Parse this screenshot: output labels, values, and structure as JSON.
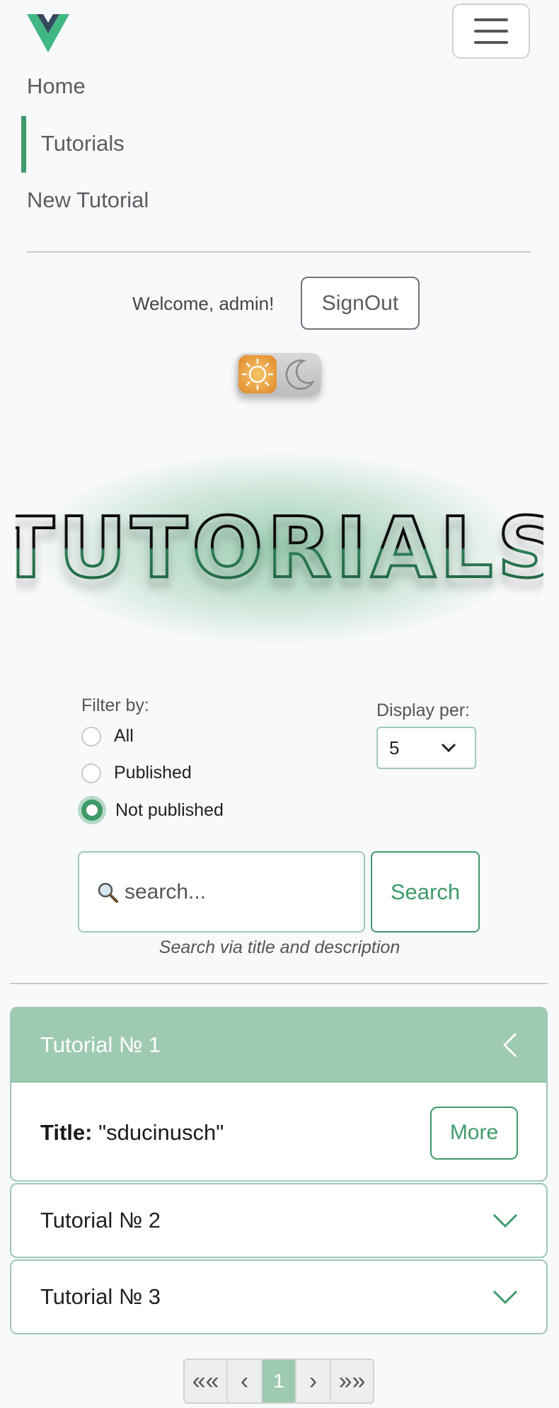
{
  "nav": {
    "items": [
      {
        "label": "Home",
        "active": false
      },
      {
        "label": "Tutorials",
        "active": true
      },
      {
        "label": "New Tutorial",
        "active": false
      }
    ],
    "menu_icon": "hamburger-icon"
  },
  "user": {
    "welcome": "Welcome, admin!",
    "signout_label": "SignOut"
  },
  "theme_toggle": {
    "light_icon": "sun-icon",
    "dark_icon": "moon-icon",
    "mode": "light"
  },
  "banner": {
    "title": "TUTORIALS"
  },
  "filter": {
    "label": "Filter by:",
    "options": [
      {
        "label": "All",
        "checked": false
      },
      {
        "label": "Published",
        "checked": false
      },
      {
        "label": "Not published",
        "checked": true
      }
    ]
  },
  "display": {
    "label": "Display per:",
    "value": "5"
  },
  "search": {
    "placeholder": "search...",
    "button_label": "Search",
    "hint": "Search via title and description"
  },
  "tutorials": [
    {
      "header": "Tutorial № 1",
      "expanded": true,
      "title_label": "Title:",
      "title_value": "\"sducinusch\"",
      "more_label": "More"
    },
    {
      "header": "Tutorial № 2",
      "expanded": false
    },
    {
      "header": "Tutorial № 3",
      "expanded": false
    }
  ],
  "pagination": {
    "first": "««",
    "prev": "‹",
    "current": "1",
    "next": "›",
    "last": "»»"
  },
  "colors": {
    "accent": "#3f9a6a",
    "accent_light": "#9ecab1",
    "border": "#9fcab3"
  }
}
